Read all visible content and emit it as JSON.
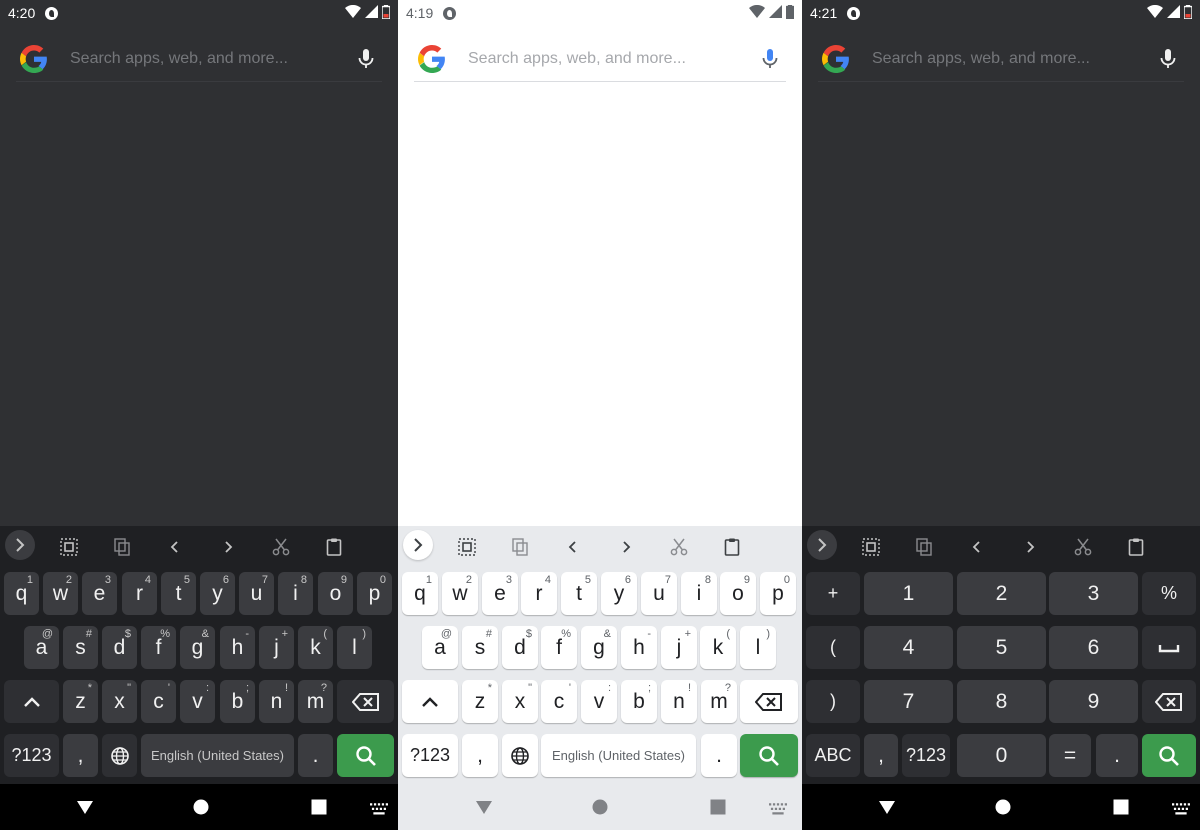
{
  "screens": [
    {
      "id": "alpha-dark",
      "time": "4:20",
      "search_placeholder": "Search apps, web, and more...",
      "space_label": "English (United States)",
      "sym_key": "?123",
      "comma": ",",
      "period": "."
    },
    {
      "id": "alpha-light",
      "time": "4:19",
      "search_placeholder": "Search apps, web, and more...",
      "space_label": "English (United States)",
      "sym_key": "?123",
      "comma": ",",
      "period": "."
    },
    {
      "id": "numeric-dark",
      "time": "4:21",
      "search_placeholder": "Search apps, web, and more..."
    }
  ],
  "keyboard": {
    "row1": [
      {
        "k": "q",
        "h": "1"
      },
      {
        "k": "w",
        "h": "2"
      },
      {
        "k": "e",
        "h": "3"
      },
      {
        "k": "r",
        "h": "4"
      },
      {
        "k": "t",
        "h": "5"
      },
      {
        "k": "y",
        "h": "6"
      },
      {
        "k": "u",
        "h": "7"
      },
      {
        "k": "i",
        "h": "8"
      },
      {
        "k": "o",
        "h": "9"
      },
      {
        "k": "p",
        "h": "0"
      }
    ],
    "row2": [
      {
        "k": "a",
        "h": "@"
      },
      {
        "k": "s",
        "h": "#"
      },
      {
        "k": "d",
        "h": "$"
      },
      {
        "k": "f",
        "h": "%"
      },
      {
        "k": "g",
        "h": "&"
      },
      {
        "k": "h",
        "h": "-"
      },
      {
        "k": "j",
        "h": "+"
      },
      {
        "k": "k",
        "h": "("
      },
      {
        "k": "l",
        "h": ")"
      }
    ],
    "row3": [
      {
        "k": "z",
        "h": "*"
      },
      {
        "k": "x",
        "h": "\""
      },
      {
        "k": "c",
        "h": "'"
      },
      {
        "k": "v",
        "h": ":"
      },
      {
        "k": "b",
        "h": ";"
      },
      {
        "k": "n",
        "h": "!"
      },
      {
        "k": "m",
        "h": "?"
      }
    ]
  },
  "numpad": {
    "row1": [
      "+",
      "1",
      "2",
      "3",
      "%"
    ],
    "row2": [
      "(",
      "4",
      "5",
      "6",
      "␣"
    ],
    "row3": [
      ")",
      "7",
      "8",
      "9",
      "⌫"
    ],
    "row4": [
      "ABC",
      ",",
      "?123",
      "0",
      "=",
      "."
    ]
  },
  "colors": {
    "dark_bg": "#2f3033",
    "kb_dark": "#1f2023",
    "key_dark": "#3b3c40",
    "light_bg": "#ffffff",
    "kb_light": "#e8eaed",
    "action_green": "#3c9b4d"
  },
  "toolbar_icons": [
    "expand-icon",
    "select-all-icon",
    "copy-icon",
    "chevron-left-icon",
    "chevron-right-icon",
    "cut-icon",
    "clipboard-icon"
  ],
  "nav_icons": [
    "back-icon",
    "home-icon",
    "recents-icon",
    "keyboard-icon"
  ]
}
